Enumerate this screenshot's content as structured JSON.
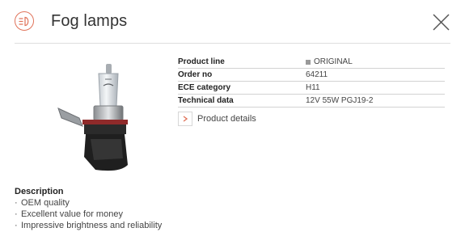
{
  "header": {
    "title": "Fog lamps",
    "icon": "fog-lamp-icon",
    "accent_color": "#e0735a"
  },
  "specs": [
    {
      "label": "Product line",
      "value": "ORIGINAL",
      "marker_color": "#999999"
    },
    {
      "label": "Order no",
      "value": "64211"
    },
    {
      "label": "ECE category",
      "value": "H11"
    },
    {
      "label": "Technical data",
      "value": "12V 55W PGJ19-2"
    }
  ],
  "details_link": {
    "label": "Product details",
    "icon": "chevron-right-icon"
  },
  "description": {
    "heading": "Description",
    "items": [
      "OEM quality",
      "Excellent value for money",
      "Impressive brightness and reliability"
    ]
  },
  "close_icon": "close-icon"
}
